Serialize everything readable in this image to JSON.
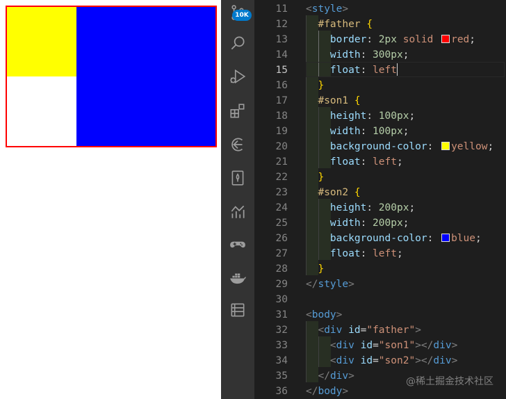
{
  "preview": {
    "colors": {
      "border": "#ff0000",
      "son1": "#ffff00",
      "son2": "#0000ff"
    }
  },
  "activity_bar": {
    "badge": "10K",
    "icons": [
      "source-control-icon",
      "search-icon",
      "run-debug-icon",
      "extensions-icon",
      "remote-explorer-icon",
      "bookmark-icon",
      "timeline-chart-icon",
      "gamepad-icon",
      "docker-icon",
      "list-icon"
    ]
  },
  "editor": {
    "active_line": "15",
    "lines": [
      {
        "n": "11",
        "t": [
          [
            "<",
            "punct"
          ],
          [
            "style",
            "tag"
          ],
          [
            ">",
            "punct"
          ]
        ]
      },
      {
        "n": "12",
        "t": [
          [
            "  ",
            "plain"
          ],
          [
            "#father",
            "sel"
          ],
          [
            " ",
            "plain"
          ],
          [
            "{",
            "brace"
          ]
        ]
      },
      {
        "n": "13",
        "t": [
          [
            "    ",
            "plain"
          ],
          [
            "border",
            "prop"
          ],
          [
            ": ",
            "plain"
          ],
          [
            "2px",
            "num"
          ],
          [
            " solid ",
            "val"
          ],
          [
            "",
            "swatch:#ff0000"
          ],
          [
            "red",
            "val"
          ],
          [
            ";",
            "plain"
          ]
        ]
      },
      {
        "n": "14",
        "t": [
          [
            "    ",
            "plain"
          ],
          [
            "width",
            "prop"
          ],
          [
            ": ",
            "plain"
          ],
          [
            "300px",
            "num"
          ],
          [
            ";",
            "plain"
          ]
        ]
      },
      {
        "n": "15",
        "t": [
          [
            "    ",
            "plain"
          ],
          [
            "float",
            "prop"
          ],
          [
            ": ",
            "plain"
          ],
          [
            "left",
            "val"
          ],
          [
            "",
            "cursor"
          ]
        ]
      },
      {
        "n": "16",
        "t": [
          [
            "  ",
            "plain"
          ],
          [
            "}",
            "brace"
          ]
        ]
      },
      {
        "n": "17",
        "t": [
          [
            "  ",
            "plain"
          ],
          [
            "#son1",
            "sel"
          ],
          [
            " ",
            "plain"
          ],
          [
            "{",
            "brace"
          ]
        ]
      },
      {
        "n": "18",
        "t": [
          [
            "    ",
            "plain"
          ],
          [
            "height",
            "prop"
          ],
          [
            ": ",
            "plain"
          ],
          [
            "100px",
            "num"
          ],
          [
            ";",
            "plain"
          ]
        ]
      },
      {
        "n": "19",
        "t": [
          [
            "    ",
            "plain"
          ],
          [
            "width",
            "prop"
          ],
          [
            ": ",
            "plain"
          ],
          [
            "100px",
            "num"
          ],
          [
            ";",
            "plain"
          ]
        ]
      },
      {
        "n": "20",
        "t": [
          [
            "    ",
            "plain"
          ],
          [
            "background-color",
            "prop"
          ],
          [
            ": ",
            "plain"
          ],
          [
            "",
            "swatch:#ffff00"
          ],
          [
            "yellow",
            "val"
          ],
          [
            ";",
            "plain"
          ]
        ]
      },
      {
        "n": "21",
        "t": [
          [
            "    ",
            "plain"
          ],
          [
            "float",
            "prop"
          ],
          [
            ": ",
            "plain"
          ],
          [
            "left",
            "val"
          ],
          [
            ";",
            "plain"
          ]
        ]
      },
      {
        "n": "22",
        "t": [
          [
            "  ",
            "plain"
          ],
          [
            "}",
            "brace"
          ]
        ]
      },
      {
        "n": "23",
        "t": [
          [
            "  ",
            "plain"
          ],
          [
            "#son2",
            "sel"
          ],
          [
            " ",
            "plain"
          ],
          [
            "{",
            "brace"
          ]
        ]
      },
      {
        "n": "24",
        "t": [
          [
            "    ",
            "plain"
          ],
          [
            "height",
            "prop"
          ],
          [
            ": ",
            "plain"
          ],
          [
            "200px",
            "num"
          ],
          [
            ";",
            "plain"
          ]
        ]
      },
      {
        "n": "25",
        "t": [
          [
            "    ",
            "plain"
          ],
          [
            "width",
            "prop"
          ],
          [
            ": ",
            "plain"
          ],
          [
            "200px",
            "num"
          ],
          [
            ";",
            "plain"
          ]
        ]
      },
      {
        "n": "26",
        "t": [
          [
            "    ",
            "plain"
          ],
          [
            "background-color",
            "prop"
          ],
          [
            ": ",
            "plain"
          ],
          [
            "",
            "swatch:#0000ff"
          ],
          [
            "blue",
            "val"
          ],
          [
            ";",
            "plain"
          ]
        ]
      },
      {
        "n": "27",
        "t": [
          [
            "    ",
            "plain"
          ],
          [
            "float",
            "prop"
          ],
          [
            ": ",
            "plain"
          ],
          [
            "left",
            "val"
          ],
          [
            ";",
            "plain"
          ]
        ]
      },
      {
        "n": "28",
        "t": [
          [
            "  ",
            "plain"
          ],
          [
            "}",
            "brace"
          ]
        ]
      },
      {
        "n": "29",
        "t": [
          [
            "</",
            "punct"
          ],
          [
            "style",
            "tag"
          ],
          [
            ">",
            "punct"
          ]
        ]
      },
      {
        "n": "30",
        "t": []
      },
      {
        "n": "31",
        "t": [
          [
            "<",
            "punct"
          ],
          [
            "body",
            "tag"
          ],
          [
            ">",
            "punct"
          ]
        ]
      },
      {
        "n": "32",
        "t": [
          [
            "  ",
            "plain"
          ],
          [
            "<",
            "punct"
          ],
          [
            "div",
            "tag"
          ],
          [
            " ",
            "plain"
          ],
          [
            "id",
            "attr"
          ],
          [
            "=",
            "plain"
          ],
          [
            "\"father\"",
            "str"
          ],
          [
            ">",
            "punct"
          ]
        ]
      },
      {
        "n": "33",
        "t": [
          [
            "    ",
            "plain"
          ],
          [
            "<",
            "punct"
          ],
          [
            "div",
            "tag"
          ],
          [
            " ",
            "plain"
          ],
          [
            "id",
            "attr"
          ],
          [
            "=",
            "plain"
          ],
          [
            "\"son1\"",
            "str"
          ],
          [
            "></",
            "punct"
          ],
          [
            "div",
            "tag"
          ],
          [
            ">",
            "punct"
          ]
        ]
      },
      {
        "n": "34",
        "t": [
          [
            "    ",
            "plain"
          ],
          [
            "<",
            "punct"
          ],
          [
            "div",
            "tag"
          ],
          [
            " ",
            "plain"
          ],
          [
            "id",
            "attr"
          ],
          [
            "=",
            "plain"
          ],
          [
            "\"son2\"",
            "str"
          ],
          [
            "></",
            "punct"
          ],
          [
            "div",
            "tag"
          ],
          [
            ">",
            "punct"
          ]
        ]
      },
      {
        "n": "35",
        "t": [
          [
            "  ",
            "plain"
          ],
          [
            "</",
            "punct"
          ],
          [
            "div",
            "tag"
          ],
          [
            ">",
            "punct"
          ]
        ]
      },
      {
        "n": "36",
        "t": [
          [
            "</",
            "punct"
          ],
          [
            "body",
            "tag"
          ],
          [
            ">",
            "punct"
          ]
        ]
      }
    ]
  },
  "watermark": "@稀土掘金技术社区",
  "theme": {
    "punct": "#808080",
    "tag": "#569cd6",
    "sel": "#d7ba7d",
    "brace": "#ffd700",
    "prop": "#9cdcfe",
    "plain": "#d4d4d4",
    "num": "#b5cea8",
    "val": "#ce9178",
    "attr": "#9cdcfe",
    "str": "#ce9178"
  }
}
